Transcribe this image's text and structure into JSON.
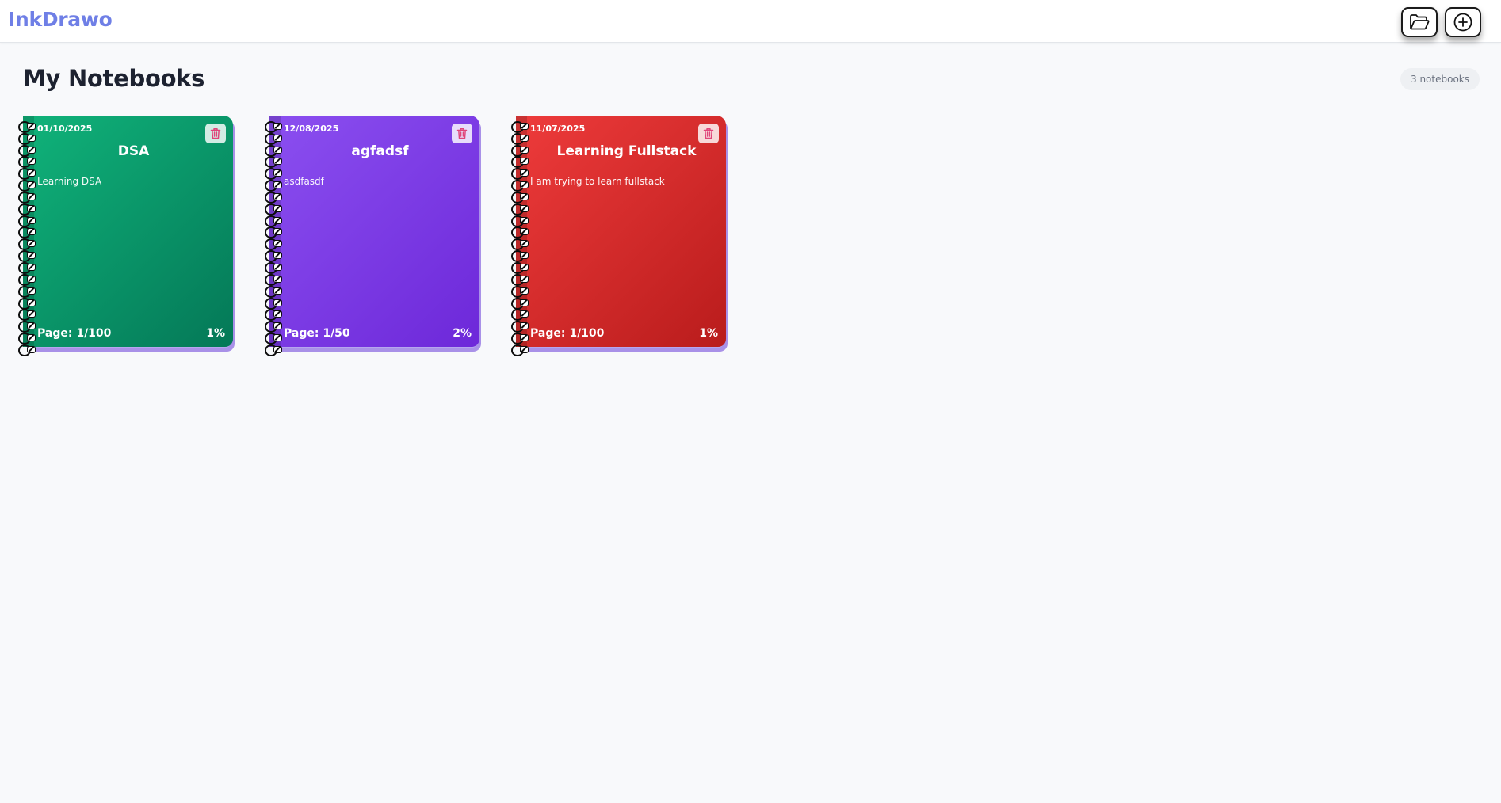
{
  "app": {
    "logo": "InkDrawo"
  },
  "toolbar": {
    "open_icon": "folder-open-icon",
    "add_icon": "plus-circle-icon"
  },
  "main": {
    "title": "My Notebooks",
    "count": "3 notebooks"
  },
  "notebooks": [
    {
      "date": "01/10/2025",
      "name": "DSA",
      "description": "Learning DSA",
      "page": "Page: 1/100",
      "progress": "1%",
      "color_start": "#10b37a",
      "color_end": "#047857",
      "delete_icon": "trash-icon",
      "delete_color": "#e0447a"
    },
    {
      "date": "12/08/2025",
      "name": "agfadsf",
      "description": "asdfasdf",
      "page": "Page: 1/50",
      "progress": "2%",
      "color_start": "#8b4ff0",
      "color_end": "#6d28d9",
      "delete_icon": "trash-icon",
      "delete_color": "#e0447a"
    },
    {
      "date": "11/07/2025",
      "name": "Learning Fullstack",
      "description": "I am trying to learn fullstack",
      "page": "Page: 1/100",
      "progress": "1%",
      "color_start": "#ee3b3b",
      "color_end": "#b91c1c",
      "delete_icon": "trash-icon",
      "delete_color": "#e0447a"
    }
  ]
}
